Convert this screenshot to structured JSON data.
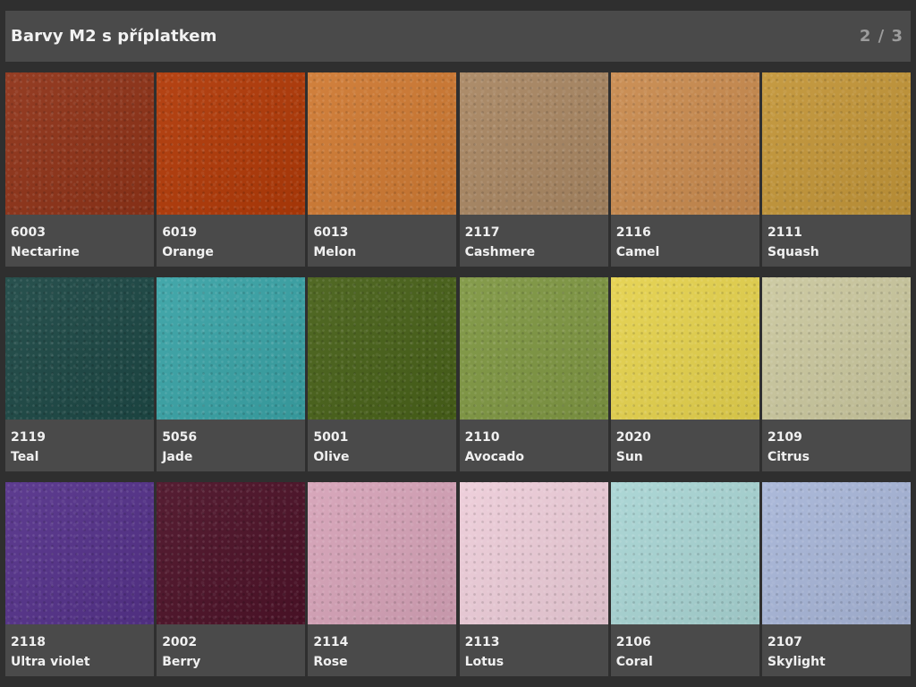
{
  "header": {
    "title": "Barvy M2 s příplatkem",
    "page": "2 / 3"
  },
  "swatches": [
    {
      "code": "6003",
      "name": "Nectarine",
      "color": "#8f3318"
    },
    {
      "code": "6019",
      "name": "Orange",
      "color": "#b13a08"
    },
    {
      "code": "6013",
      "name": "Melon",
      "color": "#cf7a33"
    },
    {
      "code": "2117",
      "name": "Cashmere",
      "color": "#a98763"
    },
    {
      "code": "2116",
      "name": "Camel",
      "color": "#c98b4f"
    },
    {
      "code": "2111",
      "name": "Squash",
      "color": "#c39639"
    },
    {
      "code": "2119",
      "name": "Teal",
      "color": "#1d4845"
    },
    {
      "code": "5056",
      "name": "Jade",
      "color": "#3aa3a6"
    },
    {
      "code": "5001",
      "name": "Olive",
      "color": "#486119"
    },
    {
      "code": "2110",
      "name": "Avocado",
      "color": "#7f9743"
    },
    {
      "code": "2020",
      "name": "Sun",
      "color": "#e5d24e"
    },
    {
      "code": "2109",
      "name": "Citrus",
      "color": "#cbc89f"
    },
    {
      "code": "2118",
      "name": "Ultra violet",
      "color": "#55328a"
    },
    {
      "code": "2002",
      "name": "Berry",
      "color": "#4d1228"
    },
    {
      "code": "2114",
      "name": "Rose",
      "color": "#d6a3b8"
    },
    {
      "code": "2113",
      "name": "Lotus",
      "color": "#edcdd9"
    },
    {
      "code": "2106",
      "name": "Coral",
      "color": "#a9d5d4"
    },
    {
      "code": "2107",
      "name": "Skylight",
      "color": "#a8b6d8"
    }
  ]
}
